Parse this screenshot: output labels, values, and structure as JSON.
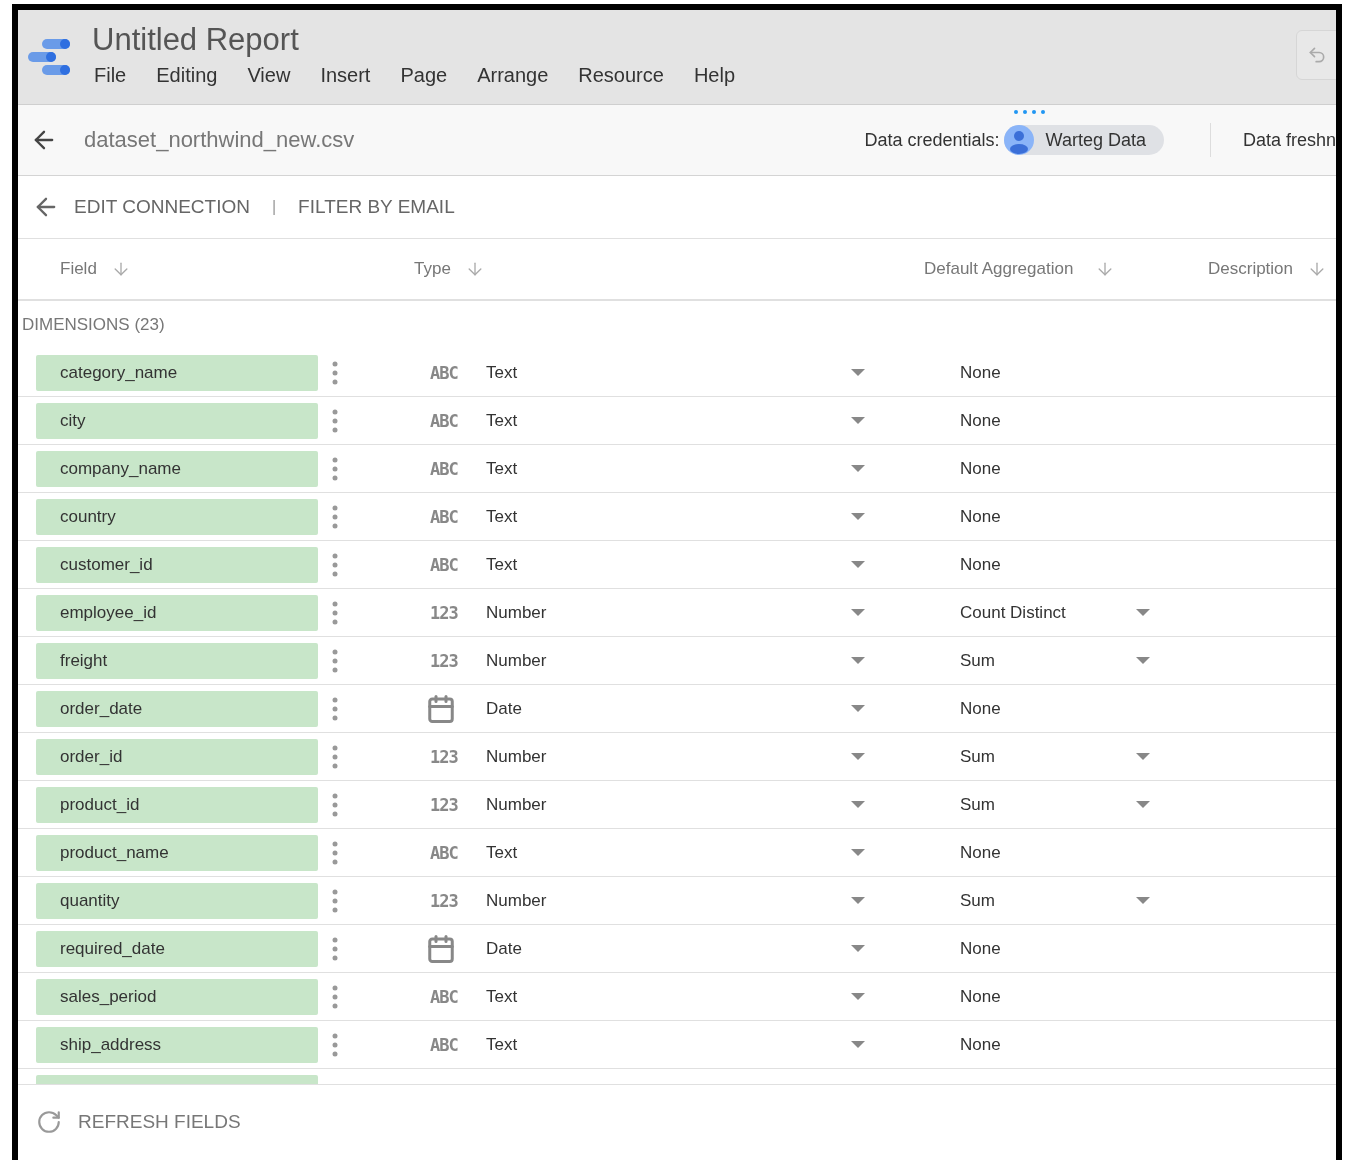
{
  "app": {
    "title": "Untitled Report",
    "menu": [
      "File",
      "Editing",
      "View",
      "Insert",
      "Page",
      "Arrange",
      "Resource",
      "Help"
    ]
  },
  "data_source": {
    "name": "dataset_northwind_new.csv",
    "credentials_label": "Data credentials:",
    "credentials_owner": "Warteg Data",
    "freshness_label": "Data freshn"
  },
  "breadcrumbs": {
    "items": [
      "EDIT CONNECTION",
      "FILTER BY EMAIL"
    ],
    "separator": "|"
  },
  "columns": [
    {
      "label": "Field"
    },
    {
      "label": "Type"
    },
    {
      "label": "Default Aggregation"
    },
    {
      "label": "Description"
    }
  ],
  "section": "DIMENSIONS (23)",
  "fields": [
    {
      "name": "category_name",
      "kind": "text",
      "type_badge": "ABC",
      "type_label": "Text",
      "aggregation": "None",
      "aggregation_editable": false
    },
    {
      "name": "city",
      "kind": "text",
      "type_badge": "ABC",
      "type_label": "Text",
      "aggregation": "None",
      "aggregation_editable": false
    },
    {
      "name": "company_name",
      "kind": "text",
      "type_badge": "ABC",
      "type_label": "Text",
      "aggregation": "None",
      "aggregation_editable": false
    },
    {
      "name": "country",
      "kind": "text",
      "type_badge": "ABC",
      "type_label": "Text",
      "aggregation": "None",
      "aggregation_editable": false
    },
    {
      "name": "customer_id",
      "kind": "text",
      "type_badge": "ABC",
      "type_label": "Text",
      "aggregation": "None",
      "aggregation_editable": false
    },
    {
      "name": "employee_id",
      "kind": "number",
      "type_badge": "123",
      "type_label": "Number",
      "aggregation": "Count Distinct",
      "aggregation_editable": true
    },
    {
      "name": "freight",
      "kind": "number",
      "type_badge": "123",
      "type_label": "Number",
      "aggregation": "Sum",
      "aggregation_editable": true
    },
    {
      "name": "order_date",
      "kind": "date",
      "type_label": "Date",
      "aggregation": "None",
      "aggregation_editable": false
    },
    {
      "name": "order_id",
      "kind": "number",
      "type_badge": "123",
      "type_label": "Number",
      "aggregation": "Sum",
      "aggregation_editable": true
    },
    {
      "name": "product_id",
      "kind": "number",
      "type_badge": "123",
      "type_label": "Number",
      "aggregation": "Sum",
      "aggregation_editable": true
    },
    {
      "name": "product_name",
      "kind": "text",
      "type_badge": "ABC",
      "type_label": "Text",
      "aggregation": "None",
      "aggregation_editable": false
    },
    {
      "name": "quantity",
      "kind": "number",
      "type_badge": "123",
      "type_label": "Number",
      "aggregation": "Sum",
      "aggregation_editable": true
    },
    {
      "name": "required_date",
      "kind": "date",
      "type_label": "Date",
      "aggregation": "None",
      "aggregation_editable": false
    },
    {
      "name": "sales_period",
      "kind": "text",
      "type_badge": "ABC",
      "type_label": "Text",
      "aggregation": "None",
      "aggregation_editable": false
    },
    {
      "name": "ship_address",
      "kind": "text",
      "type_badge": "ABC",
      "type_label": "Text",
      "aggregation": "None",
      "aggregation_editable": false
    }
  ],
  "footer_action": "REFRESH FIELDS"
}
